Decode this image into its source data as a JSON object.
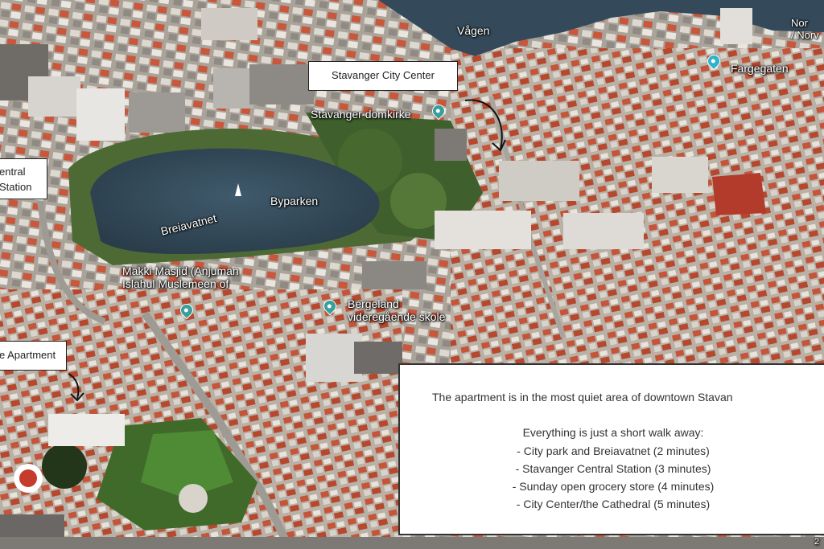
{
  "map": {
    "labels": {
      "vagen": "Vågen",
      "fargegaten": "Fargegaten",
      "norway_partial": "Nor\n/ Norv",
      "domkirke": "Stavanger domkirke",
      "byparken": "Byparken",
      "breiavatnet": "Breiavatnet",
      "makki": "Makki Masjid (Anjuman\nIslahul Muslemeen of",
      "bergeland": "Bergeland\nvideregående skole"
    },
    "callouts": {
      "city_center": "Stavanger City Center",
      "central_station": "entral\nStation",
      "apartment": "e Apartment"
    },
    "pin_colors": {
      "teal": "#3a9e9a",
      "cyan": "#2fb3c9"
    }
  },
  "info": {
    "headline": "The apartment is in the most quiet area of downtown Stavan",
    "intro": "Everything is just a short walk away:",
    "items": [
      "- City park and Breiavatnet (2 minutes)",
      "- Stavanger Central Station (3 minutes)",
      "- Sunday open grocery store (4 minutes)",
      "- City Center/the Cathedral (5 minutes)"
    ]
  },
  "corner_text": "2"
}
